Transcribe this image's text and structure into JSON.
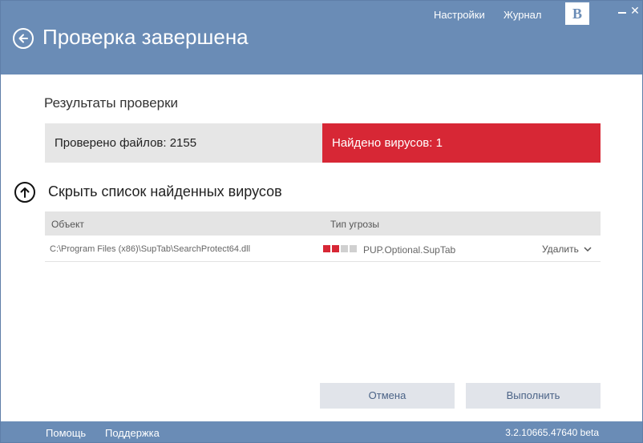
{
  "header": {
    "title": "Проверка завершена",
    "links": {
      "settings": "Настройки",
      "journal": "Журнал"
    },
    "logo_letter": "B"
  },
  "results": {
    "section_title": "Результаты проверки",
    "files_checked": "Проверено файлов: 2155",
    "viruses_found": "Найдено вирусов: 1"
  },
  "toggle": {
    "label": "Скрыть список найденных вирусов"
  },
  "table": {
    "columns": [
      "Объект",
      "Тип угрозы"
    ],
    "rows": [
      {
        "path": "C:\\Program Files (x86)\\SupTab\\SearchProtect64.dll",
        "threat": "PUP.Optional.SupTab",
        "severity_level": 2,
        "severity_max": 4,
        "action": "Удалить"
      }
    ]
  },
  "buttons": {
    "cancel": "Отмена",
    "execute": "Выполнить"
  },
  "footer": {
    "help": "Помощь",
    "support": "Поддержка",
    "version": "3.2.10665.47640 beta"
  },
  "colors": {
    "header": "#6a8cb6",
    "danger": "#d72735",
    "neutral": "#e6e6e6",
    "severity_off": "#d0d0d0"
  }
}
